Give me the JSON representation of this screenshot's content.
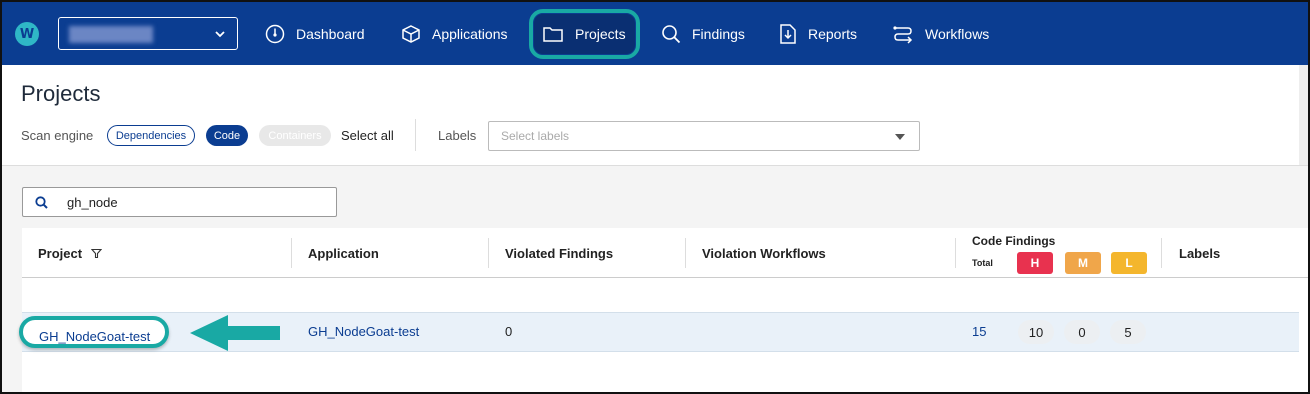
{
  "nav": {
    "items": [
      {
        "label": "Dashboard",
        "icon": "dashboard-gauge-icon"
      },
      {
        "label": "Applications",
        "icon": "cube-icon"
      },
      {
        "label": "Projects",
        "icon": "folder-icon"
      },
      {
        "label": "Findings",
        "icon": "search-icon"
      },
      {
        "label": "Reports",
        "icon": "report-download-icon"
      },
      {
        "label": "Workflows",
        "icon": "workflow-icon"
      }
    ],
    "active": "Projects",
    "highlight_color": "#19a9a4",
    "bar_color": "#0b3d91"
  },
  "page": {
    "title": "Projects",
    "scan_engine_label": "Scan engine",
    "chips": [
      "Dependencies",
      "Code",
      "Containers"
    ],
    "selected_chip": "Code",
    "select_all": "Select all",
    "labels_label": "Labels",
    "labels_placeholder": "Select labels"
  },
  "search": {
    "value": "gh_node"
  },
  "table": {
    "headers": [
      "Project",
      "Application",
      "Violated Findings",
      "Violation Workflows",
      "Code Findings",
      "Labels"
    ],
    "code_findings_total_label": "Total",
    "severity_labels": [
      "H",
      "M",
      "L"
    ],
    "severity_colors": {
      "H": "#e8324f",
      "M": "#f0a64a",
      "L": "#f4b62d"
    },
    "rows": [
      {
        "project": "GH_NodeGoat-test",
        "application": "GH_NodeGoat-test",
        "violated_findings": "0",
        "total": "15",
        "high": "10",
        "medium": "0",
        "low": "5"
      }
    ]
  }
}
